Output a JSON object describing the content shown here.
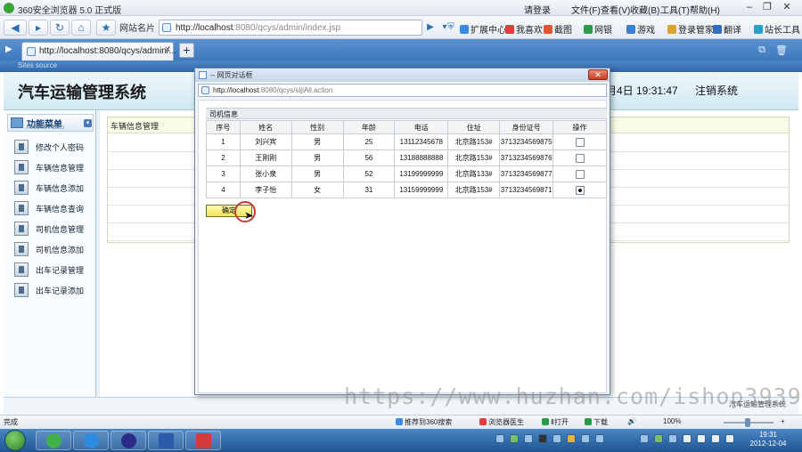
{
  "browser": {
    "title": "360安全浏览器 5.0 正式版",
    "menus": [
      "请登录",
      "文件(F)",
      "查看(V)",
      "收藏(B)",
      "工具(T)",
      "帮助(H)"
    ],
    "favorites_label": "网站名片",
    "address": {
      "host": "http://localhost",
      "rest": ":8080/qcys/admin/index.jsp"
    },
    "toolbar": [
      "扩展中心",
      "我喜欢",
      "截图",
      "网银",
      "游戏",
      "登录管家",
      "翻译",
      "站长工具"
    ],
    "tab_label": "http://localhost:8080/qcys/admin/...",
    "new_tab": "+",
    "inner_title": "Sites source"
  },
  "page": {
    "system_title": "汽车运输管理系统",
    "datetime": "月4日 19:31:47",
    "logout": "注销系统",
    "menu_title": "功能菜单",
    "menu_subtitle": "FUNCTION MENU",
    "menu_items": [
      "修改个人密码",
      "车辆信息管理",
      "车辆信息添加",
      "车辆信息查询",
      "司机信息管理",
      "司机信息添加",
      "出车记录管理",
      "出车记录添加"
    ],
    "content_header": "车辆信息管理",
    "footer_note": "汽车运输管理系统"
  },
  "dialog": {
    "title": "-- 网页对话框",
    "address": {
      "host": "http://localhost",
      "rest": ":8080/qcys/sijiAll.action"
    },
    "section_title": "司机信息",
    "columns": [
      "序号",
      "姓名",
      "性别",
      "年龄",
      "电话",
      "住址",
      "身份证号",
      "操作"
    ],
    "rows": [
      [
        "1",
        "刘兴宾",
        "男",
        "25",
        "13112345678",
        "北京路153#",
        "3713234569875",
        false
      ],
      [
        "2",
        "王刚刚",
        "男",
        "56",
        "13188888888",
        "北京路153#",
        "3713234569876",
        false
      ],
      [
        "3",
        "张小泉",
        "男",
        "52",
        "13199999999",
        "北京路133#",
        "3713234569877",
        false
      ],
      [
        "4",
        "李子怡",
        "女",
        "31",
        "13159999999",
        "北京路153#",
        "3713234569871",
        true
      ]
    ],
    "ok_label": "确定"
  },
  "watermark": "https://www.huzhan.com/ishop39397",
  "statusbar": {
    "left": "完成",
    "items": [
      "推荐到360搜索",
      "浏览器医生",
      "Ⅱ打开",
      "下载"
    ],
    "zoom": "100%"
  },
  "taskbar": {
    "time": "19:31",
    "date": "2012-12-04"
  }
}
